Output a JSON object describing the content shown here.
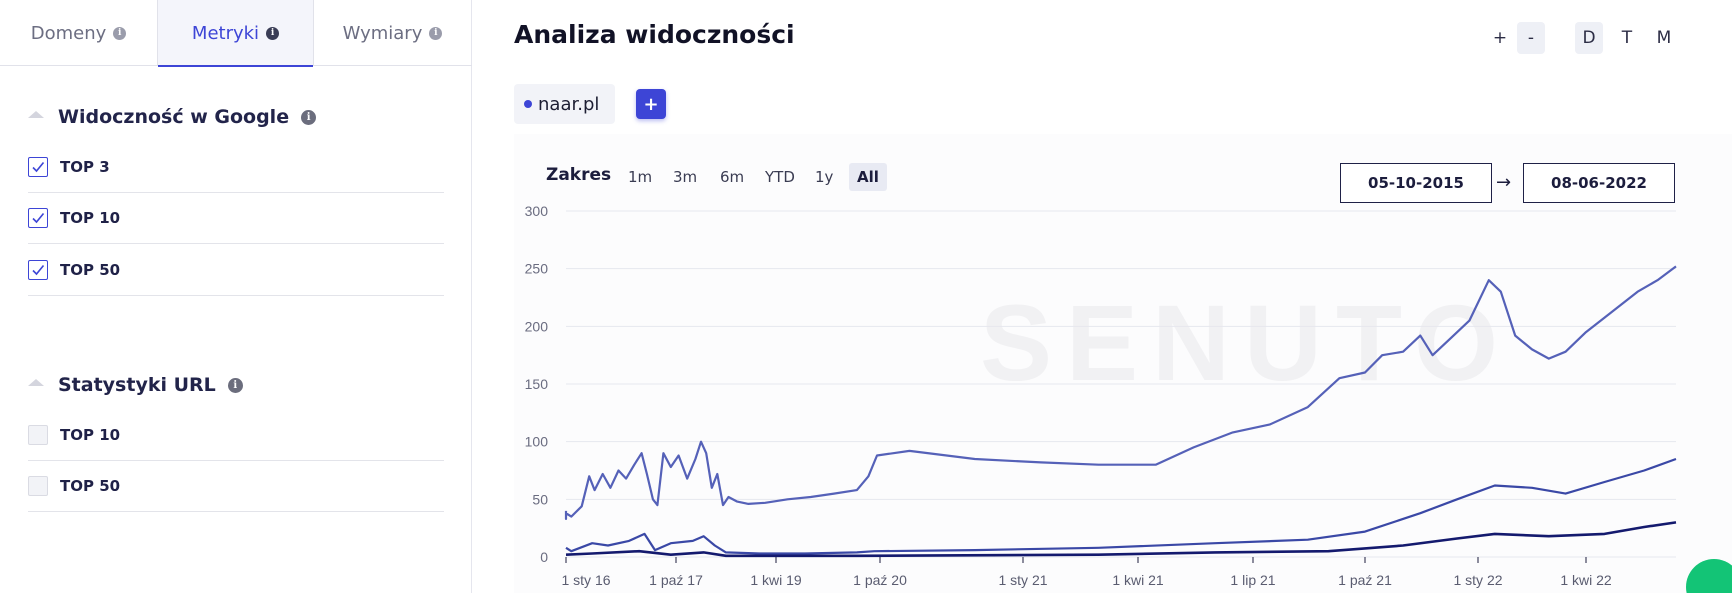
{
  "sidebar": {
    "tabs": [
      {
        "label": "Domeny",
        "active": false
      },
      {
        "label": "Metryki",
        "active": true
      },
      {
        "label": "Wymiary",
        "active": false
      }
    ],
    "sections": [
      {
        "title": "Widoczność w Google",
        "items": [
          {
            "label": "TOP 3",
            "checked": true
          },
          {
            "label": "TOP 10",
            "checked": true
          },
          {
            "label": "TOP 50",
            "checked": true
          }
        ]
      },
      {
        "title": "Statystyki URL",
        "items": [
          {
            "label": "TOP 10",
            "checked": false
          },
          {
            "label": "TOP 50",
            "checked": false
          }
        ]
      }
    ]
  },
  "main": {
    "title": "Analiza widoczności",
    "zoom_in": "+",
    "zoom_out": "-",
    "granularity": [
      "D",
      "T",
      "M"
    ],
    "selected_granularity": "D",
    "domain": "naar.pl",
    "add_button": "+",
    "range_label": "Zakres",
    "range_buttons": [
      "1m",
      "3m",
      "6m",
      "YTD",
      "1y",
      "All"
    ],
    "selected_range": "All",
    "date_from": "05-10-2015",
    "date_to": "08-06-2022",
    "date_arrow": "→",
    "watermark": "SENUTO"
  },
  "colors": {
    "accent": "#3d45d6",
    "top50_line": "#5561b8",
    "top10_line": "#3a48a6",
    "top3_line": "#141a6e",
    "badge": "#13c476"
  },
  "chart_data": {
    "type": "line",
    "y_ticks": [
      0,
      50,
      100,
      150,
      200,
      250,
      300
    ],
    "ylim": [
      0,
      300
    ],
    "x_ticks": [
      "1 sty 16",
      "1 paź 17",
      "1 kwi 19",
      "1 paź 20",
      "1 sty 21",
      "1 kwi 21",
      "1 lip 21",
      "1 paź 21",
      "1 sty 22",
      "1 kwi 22"
    ],
    "x_range": [
      "2015-10-05",
      "2022-06-08"
    ],
    "grid": true,
    "series": [
      {
        "name": "TOP 50",
        "points": [
          [
            "2015-10-05",
            40
          ],
          [
            "2015-11-01",
            33
          ],
          [
            "2015-12-15",
            38
          ],
          [
            "2016-02-01",
            35
          ],
          [
            "2016-04-01",
            44
          ],
          [
            "2016-05-15",
            70
          ],
          [
            "2016-06-15",
            58
          ],
          [
            "2016-08-01",
            72
          ],
          [
            "2016-09-15",
            60
          ],
          [
            "2016-11-01",
            75
          ],
          [
            "2016-12-15",
            68
          ],
          [
            "2017-02-01",
            80
          ],
          [
            "2017-03-15",
            90
          ],
          [
            "2017-04-15",
            72
          ],
          [
            "2017-05-20",
            50
          ],
          [
            "2017-06-15",
            45
          ],
          [
            "2017-07-20",
            90
          ],
          [
            "2017-09-01",
            78
          ],
          [
            "2017-10-15",
            88
          ],
          [
            "2017-12-01",
            68
          ],
          [
            "2018-01-15",
            85
          ],
          [
            "2018-02-15",
            100
          ],
          [
            "2018-03-15",
            90
          ],
          [
            "2018-04-15",
            60
          ],
          [
            "2018-05-15",
            72
          ],
          [
            "2018-06-15",
            45
          ],
          [
            "2018-07-15",
            52
          ],
          [
            "2018-09-01",
            48
          ],
          [
            "2018-11-01",
            46
          ],
          [
            "2019-02-01",
            47
          ],
          [
            "2019-06-01",
            50
          ],
          [
            "2019-10-01",
            52
          ],
          [
            "2020-02-01",
            55
          ],
          [
            "2020-06-01",
            58
          ],
          [
            "2020-08-01",
            70
          ],
          [
            "2020-09-15",
            88
          ],
          [
            "2020-10-20",
            92
          ],
          [
            "2020-12-01",
            85
          ],
          [
            "2021-01-15",
            82
          ],
          [
            "2021-03-01",
            80
          ],
          [
            "2021-04-15",
            80
          ],
          [
            "2021-05-15",
            95
          ],
          [
            "2021-06-15",
            108
          ],
          [
            "2021-07-15",
            115
          ],
          [
            "2021-08-15",
            130
          ],
          [
            "2021-09-10",
            155
          ],
          [
            "2021-10-01",
            160
          ],
          [
            "2021-10-15",
            175
          ],
          [
            "2021-11-01",
            178
          ],
          [
            "2021-11-15",
            192
          ],
          [
            "2021-11-25",
            175
          ],
          [
            "2021-12-10",
            190
          ],
          [
            "2021-12-25",
            205
          ],
          [
            "2022-01-10",
            240
          ],
          [
            "2022-01-20",
            230
          ],
          [
            "2022-02-01",
            192
          ],
          [
            "2022-02-15",
            180
          ],
          [
            "2022-03-01",
            172
          ],
          [
            "2022-03-15",
            178
          ],
          [
            "2022-04-01",
            195
          ],
          [
            "2022-04-20",
            212
          ],
          [
            "2022-05-10",
            230
          ],
          [
            "2022-05-25",
            240
          ],
          [
            "2022-06-08",
            252
          ]
        ]
      },
      {
        "name": "TOP 10",
        "points": [
          [
            "2015-10-05",
            8
          ],
          [
            "2016-02-01",
            5
          ],
          [
            "2016-06-01",
            12
          ],
          [
            "2016-09-01",
            10
          ],
          [
            "2017-01-01",
            14
          ],
          [
            "2017-04-01",
            20
          ],
          [
            "2017-06-01",
            6
          ],
          [
            "2017-09-01",
            12
          ],
          [
            "2018-01-01",
            14
          ],
          [
            "2018-03-01",
            18
          ],
          [
            "2018-05-01",
            10
          ],
          [
            "2018-07-01",
            4
          ],
          [
            "2019-01-01",
            3
          ],
          [
            "2019-09-01",
            3
          ],
          [
            "2020-06-01",
            4
          ],
          [
            "2020-09-01",
            5
          ],
          [
            "2020-12-01",
            6
          ],
          [
            "2021-03-01",
            8
          ],
          [
            "2021-06-01",
            12
          ],
          [
            "2021-08-15",
            15
          ],
          [
            "2021-10-01",
            22
          ],
          [
            "2021-11-15",
            38
          ],
          [
            "2021-12-15",
            50
          ],
          [
            "2022-01-15",
            62
          ],
          [
            "2022-02-15",
            60
          ],
          [
            "2022-03-15",
            55
          ],
          [
            "2022-04-15",
            65
          ],
          [
            "2022-05-15",
            75
          ],
          [
            "2022-06-08",
            85
          ]
        ]
      },
      {
        "name": "TOP 3",
        "points": [
          [
            "2015-10-05",
            2
          ],
          [
            "2016-06-01",
            3
          ],
          [
            "2017-03-01",
            5
          ],
          [
            "2017-09-01",
            2
          ],
          [
            "2018-03-01",
            4
          ],
          [
            "2018-07-01",
            1
          ],
          [
            "2019-01-01",
            1
          ],
          [
            "2020-06-01",
            1
          ],
          [
            "2021-03-01",
            2
          ],
          [
            "2021-06-01",
            4
          ],
          [
            "2021-09-01",
            5
          ],
          [
            "2021-11-01",
            10
          ],
          [
            "2021-12-15",
            16
          ],
          [
            "2022-01-15",
            20
          ],
          [
            "2022-03-01",
            18
          ],
          [
            "2022-04-15",
            20
          ],
          [
            "2022-05-15",
            26
          ],
          [
            "2022-06-08",
            30
          ]
        ]
      }
    ]
  }
}
